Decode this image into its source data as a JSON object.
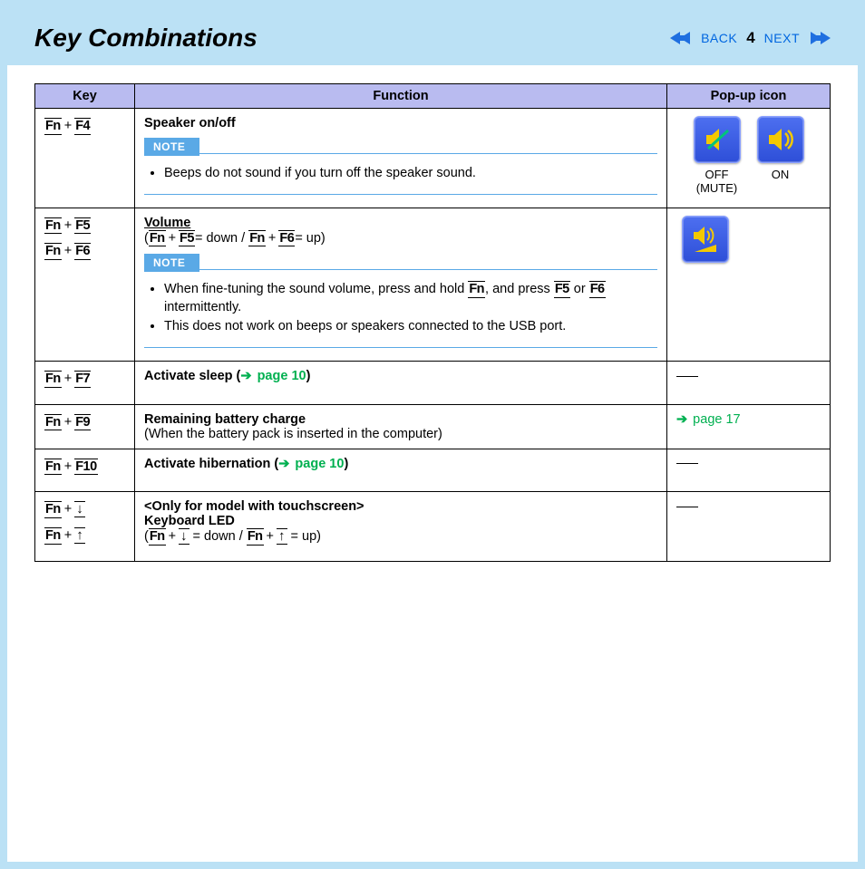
{
  "header": {
    "title": "Key Combinations",
    "back": "BACK",
    "next": "NEXT",
    "page": "4"
  },
  "table": {
    "headers": {
      "key": "Key",
      "func": "Function",
      "popup": "Pop-up icon"
    },
    "note_label": "NOTE"
  },
  "rows": {
    "r1": {
      "key_fn": "Fn",
      "key_plus": "+",
      "key_f": "F4",
      "title": "Speaker on/off",
      "note1": "Beeps do not sound if you turn off the speaker sound.",
      "off_label": "OFF",
      "mute_label": "(MUTE)",
      "on_label": "ON"
    },
    "r2": {
      "key_fn": "Fn",
      "key_plus": "+",
      "key_f5": "F5",
      "key_f6": "F6",
      "title": "Volume",
      "sub_open": "(",
      "eq_down": "= down / ",
      "eq_up": "= up)",
      "note1a": "When fine-tuning the sound volume, press and hold ",
      "note1b": ", and press ",
      "note1c": " or ",
      "note1d": " intermittently.",
      "note2": "This does not work on beeps or speakers connected to the USB port."
    },
    "r3": {
      "key_fn": "Fn",
      "key_plus": "+",
      "key_f": "F7",
      "title_a": "Activate sleep (",
      "link": " page 10",
      "title_b": ")"
    },
    "r4": {
      "key_fn": "Fn",
      "key_plus": "+",
      "key_f": "F9",
      "title": "Remaining battery charge",
      "sub": "(When the battery pack is inserted in the computer)",
      "link": " page 17"
    },
    "r5": {
      "key_fn": "Fn",
      "key_plus": "+",
      "key_f": "F10",
      "title_a": "Activate hibernation (",
      "link": " page 10",
      "title_b": ")"
    },
    "r6": {
      "key_fn": "Fn",
      "key_plus": "+",
      "title1": "<Only for model with touchscreen>",
      "title2": "Keyboard LED",
      "sub_open": "(",
      "eq_down": " = down / ",
      "eq_up": " = up)"
    }
  }
}
